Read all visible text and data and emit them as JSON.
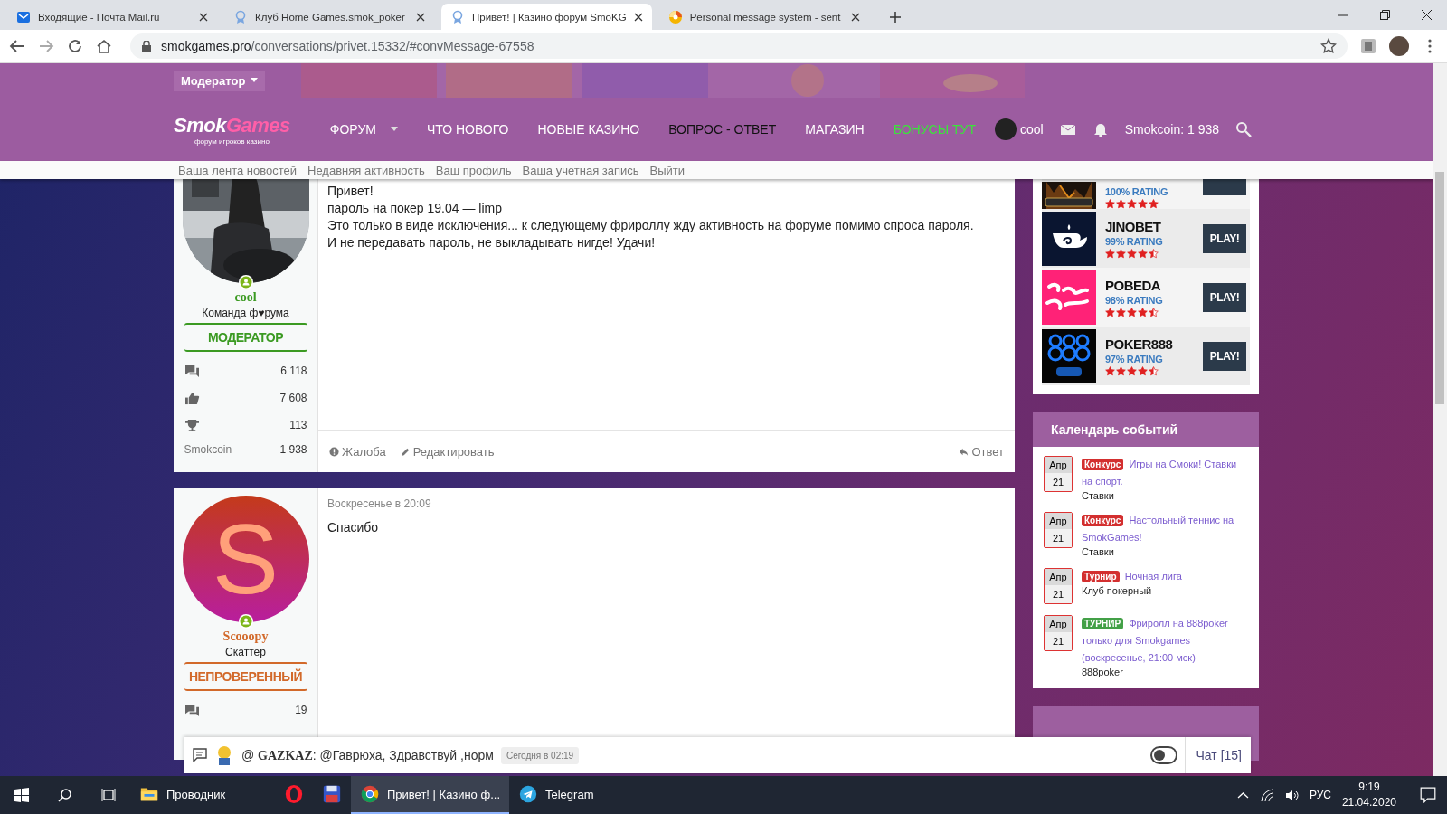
{
  "browser": {
    "tabs": [
      {
        "title": "Входящие - Почта Mail.ru",
        "kind": "mail",
        "selected": false
      },
      {
        "title": "Клуб Home Games.smok_poker",
        "kind": "badge",
        "selected": false
      },
      {
        "title": "Привет! | Казино форум SmoKG",
        "kind": "badge",
        "selected": true
      },
      {
        "title": "Personal message system - sent",
        "kind": "pinwheel",
        "selected": false
      }
    ],
    "url_host": "smokgames.pro",
    "url_path": "/conversations/privet.15332/#convMessage-67558"
  },
  "header": {
    "role_menu": "Модератор",
    "logo": [
      "Smok",
      "Games"
    ],
    "logo_sub": "форум игроков казино",
    "nav": [
      {
        "label": "ФОРУМ",
        "dropdown": true,
        "color": "#ffffff"
      },
      {
        "label": "ЧТО НОВОГО",
        "dropdown": false,
        "color": "#ffffff"
      },
      {
        "label": "НОВЫЕ КАЗИНО",
        "dropdown": false,
        "color": "#ffffff"
      },
      {
        "label": "ВОПРОС - ОТВЕТ",
        "dropdown": false,
        "color": "#111111"
      },
      {
        "label": "МАГАЗИН",
        "dropdown": false,
        "color": "#ffffff"
      },
      {
        "label": "БОНУСЫ ТУТ",
        "dropdown": false,
        "color": "#3be43b"
      }
    ],
    "user": "cool",
    "smokcoin": "Smokcoin: 1 938"
  },
  "subnav": [
    "Ваша лента новостей",
    "Недавняя активность",
    "Ваш профиль",
    "Ваша учетная запись",
    "Выйти"
  ],
  "posts": [
    {
      "avatar": {
        "kind": "picture"
      },
      "online": true,
      "user": "cool",
      "color": "#3b9a22",
      "user_title": "Команда ф♥рума",
      "banner": "МОДЕРАТОР",
      "stats": [
        {
          "kind": "messages",
          "value": "6 118"
        },
        {
          "kind": "likes",
          "value": "7 608"
        },
        {
          "kind": "trophies",
          "value": "113"
        },
        {
          "kind": "label",
          "label": "Smokcoin",
          "value": "1 938"
        }
      ],
      "body": [
        "Привет!",
        "пароль на покер 19.04 — limp",
        "Это только в виде исключения... к следующему фрироллу жду активность на форуме помимо спроса пароля.",
        "И не передавать пароль, не выкладывать нигде! Удачи!"
      ],
      "actions": [
        {
          "kind": "report",
          "label": "Жалоба"
        },
        {
          "kind": "edit",
          "label": "Редактировать"
        },
        {
          "kind": "reply",
          "label": "Ответ"
        }
      ]
    },
    {
      "avatar": {
        "kind": "letter",
        "letter": "S"
      },
      "online": true,
      "user": "Scooopy",
      "color": "#d2692a",
      "user_title": "Скаттер",
      "banner": "НЕПРОВЕРЕННЫЙ",
      "stats": [
        {
          "kind": "messages",
          "value": "19"
        }
      ],
      "date": "Воскресенье в 20:09",
      "body": [
        "Спасибо"
      ]
    }
  ],
  "casinos": [
    {
      "kind": "partial",
      "rating": "100% RATING",
      "stars": 5
    },
    {
      "kind": "full",
      "name": "JINOBET",
      "rating": "99% RATING",
      "stars": 4.5,
      "play": "PLAY!"
    },
    {
      "kind": "full",
      "name": "POBEDA",
      "rating": "98% RATING",
      "stars": 4.5,
      "play": "PLAY!"
    },
    {
      "kind": "full",
      "name": "POKER888",
      "rating": "97% RATING",
      "stars": 4.5,
      "play": "PLAY!"
    }
  ],
  "calendar": {
    "title": "Календарь событий",
    "events": [
      {
        "month": "Апр",
        "day": "21",
        "tag": "Конкурс",
        "color": "#d32f2f",
        "title": "Игры на Смоки! Ставки на спорт.",
        "category": "Ставки"
      },
      {
        "month": "Апр",
        "day": "21",
        "tag": "Конкурс",
        "color": "#d32f2f",
        "title": "Настольный теннис на SmokGames!",
        "category": "Ставки"
      },
      {
        "month": "Апр",
        "day": "21",
        "tag": "Турнир",
        "color": "#d32f2f",
        "title": "Ночная лига",
        "category": "Клуб покерный"
      },
      {
        "month": "Апр",
        "day": "21",
        "tag": "ТУРНИР",
        "color": "#43a047",
        "title": "Фриролл на 888poker только для Smokgames (воскресенье, 21:00 мск)",
        "category": "888poker"
      }
    ]
  },
  "chat": {
    "at": "@",
    "author": "GAZKAZ",
    "message": ": @Гаврюха, Здравствуй ,норм",
    "time": "Сегодня в 02:19",
    "toggle_on": false,
    "label": "Чат",
    "count": "[15]"
  },
  "taskbar": {
    "apps": [
      {
        "kind": "explorer",
        "label": "Проводник",
        "selected": false
      },
      {
        "kind": "opera",
        "selected": false
      },
      {
        "kind": "floppy",
        "selected": false
      },
      {
        "kind": "chrome",
        "label": "Привет! | Казино ф...",
        "selected": true
      },
      {
        "kind": "telegram",
        "label": "Telegram",
        "selected": false
      }
    ],
    "lang": "РУС",
    "time": "9:19",
    "date": "21.04.2020"
  }
}
